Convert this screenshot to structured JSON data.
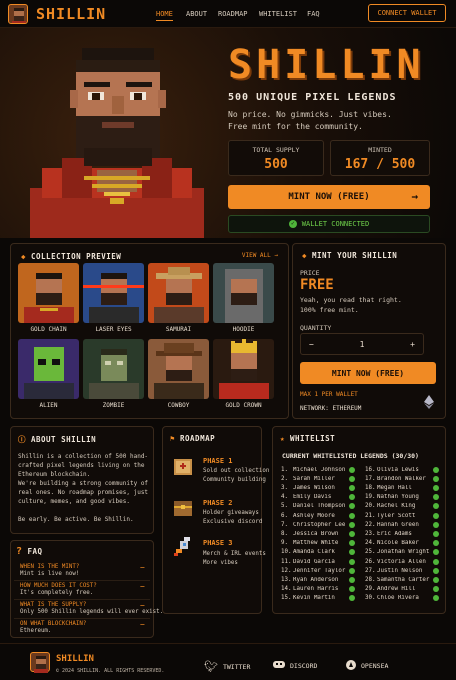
{
  "header": {
    "brand": "SHILLIN",
    "nav": [
      "HOME",
      "ABOUT",
      "ROADMAP",
      "WHITELIST",
      "FAQ"
    ],
    "connect_label": "CONNECT WALLET"
  },
  "hero": {
    "title": "SHILLIN",
    "subtitle": "500 UNIQUE PIXEL LEGENDS",
    "tagline1": "No price. No gimmicks. Just vibes.",
    "tagline2": "Free mint for the community.",
    "supply_label": "TOTAL SUPPLY",
    "supply_value": "500",
    "minted_label": "MINTED",
    "minted_value": "167 / 500",
    "mint_button": "MINT NOW (FREE)",
    "connected_label": "WALLET CONNECTED"
  },
  "collection": {
    "title": "COLLECTION PREVIEW",
    "view_all": "VIEW ALL →",
    "items": [
      "GOLD CHAIN",
      "LASER EYES",
      "SAMURAI",
      "HOODIE",
      "ALIEN",
      "ZOMBIE",
      "COWBOY",
      "GOLD CROWN"
    ]
  },
  "mint_panel": {
    "title": "MINT YOUR SHILLIN",
    "price_label": "PRICE",
    "price": "FREE",
    "note1": "Yeah, you read that right.",
    "note2": "100% free mint.",
    "quantity_label": "QUANTITY",
    "quantity": "1",
    "minus": "−",
    "plus": "+",
    "button": "MINT NOW (FREE)",
    "max": "MAX 1 PER WALLET",
    "network": "NETWORK: ETHEREUM"
  },
  "about": {
    "title": "ABOUT SHILLIN",
    "p1": "Shillin is a collection of 500 hand-crafted pixel legends living on the Ethereum blockchain.",
    "p2": "We're building a strong community of real ones. No roadmap promises, just culture, memes, and good vibes.",
    "p3": "Be early. Be active. Be Shillin."
  },
  "roadmap": {
    "title": "ROADMAP",
    "phases": [
      {
        "title": "PHASE 1",
        "l1": "Sold out collection",
        "l2": "Community building"
      },
      {
        "title": "PHASE 2",
        "l1": "Holder giveaways",
        "l2": "Exclusive discord"
      },
      {
        "title": "PHASE 3",
        "l1": "Merch & IRL events",
        "l2": "More vibes"
      }
    ]
  },
  "whitelist": {
    "title": "WHITELIST",
    "heading": "CURRENT WHITELISTED LEGENDS (30/30)",
    "names": [
      "Michael Johnson",
      "Sarah Miller",
      "James Wilson",
      "Emily Davis",
      "Daniel Thompson",
      "Ashley Moore",
      "Christopher Lee",
      "Jessica Brown",
      "Matthew White",
      "Amanda Clark",
      "David Garcia",
      "Jennifer Taylor",
      "Ryan Anderson",
      "Lauren Harris",
      "Kevin Martin",
      "Olivia Lewis",
      "Brandon Walker",
      "Megan Hall",
      "Nathan Young",
      "Rachel King",
      "Tyler Scott",
      "Hannah Green",
      "Eric Adams",
      "Nicole Baker",
      "Jonathan Wright",
      "Victoria Allen",
      "Justin Nelson",
      "Samantha Carter",
      "Andrew Hill",
      "Chloe Rivera"
    ]
  },
  "faq": {
    "title": "FAQ",
    "items": [
      {
        "q": "WHEN IS THE MINT?",
        "a": "Mint is live now!"
      },
      {
        "q": "HOW MUCH DOES IT COST?",
        "a": "It's completely free."
      },
      {
        "q": "WHAT IS THE SUPPLY?",
        "a": "Only 500 Shillin legends will ever exist."
      },
      {
        "q": "ON WHAT BLOCKCHAIN?",
        "a": "Ethereum."
      }
    ]
  },
  "footer": {
    "brand": "SHILLIN",
    "copyright": "© 2024 SHILLIN. ALL RIGHTS RESERVED.",
    "twitter": "TWITTER",
    "discord": "DISCORD",
    "opensea": "OPENSEA"
  }
}
